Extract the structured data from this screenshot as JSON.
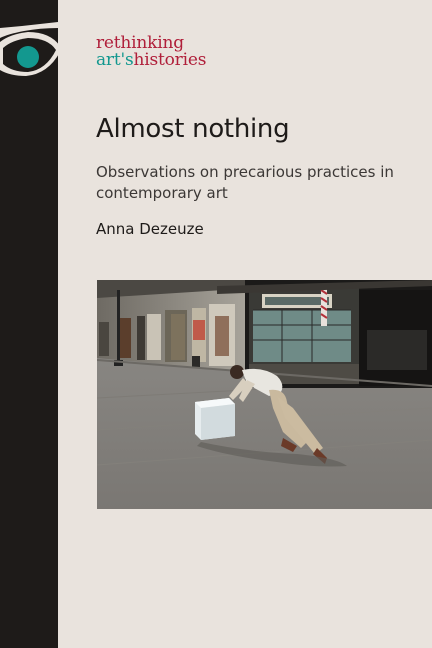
{
  "series": {
    "line1": "rethinking",
    "line2_part1": "art's",
    "line2_part2": "histories"
  },
  "book": {
    "title": "Almost nothing",
    "subtitle": "Observations on precarious practices in contemporary art",
    "author": "Anna Dezeuze"
  },
  "colors": {
    "background": "#e9e3dd",
    "spine": "#1e1b19",
    "series_red": "#b01f3a",
    "series_teal": "#13988f"
  },
  "icons": {
    "series_logo": "eye-logo-icon"
  },
  "photo": {
    "subject": "cover-photo"
  }
}
